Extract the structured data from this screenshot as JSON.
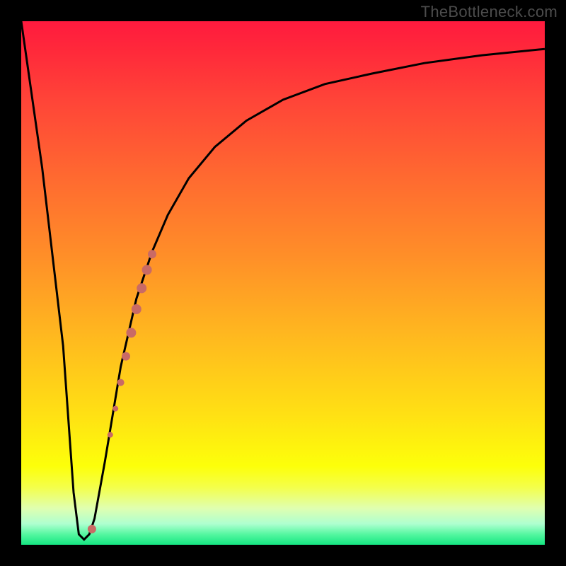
{
  "watermark": "TheBottleneck.com",
  "chart_data": {
    "type": "line",
    "title": "",
    "xlabel": "",
    "ylabel": "",
    "xlim": [
      0,
      100
    ],
    "ylim": [
      0,
      100
    ],
    "series": [
      {
        "name": "bottleneck-curve",
        "x": [
          0,
          4,
          8,
          10,
          11,
          12,
          13,
          14,
          16,
          19,
          22,
          25,
          28,
          32,
          37,
          43,
          50,
          58,
          67,
          77,
          88,
          100
        ],
        "y": [
          100,
          72,
          38,
          10,
          2,
          1,
          2,
          5,
          16,
          34,
          47,
          56,
          63,
          70,
          76,
          81,
          85,
          88,
          90,
          92,
          93.5,
          94.7
        ]
      }
    ],
    "markers": {
      "name": "highlight-dots",
      "color": "#c96a65",
      "points": [
        {
          "x": 13.5,
          "y": 3.0,
          "r": 6
        },
        {
          "x": 17.0,
          "y": 21.0,
          "r": 4
        },
        {
          "x": 18.0,
          "y": 26.0,
          "r": 4
        },
        {
          "x": 19.0,
          "y": 31.0,
          "r": 5
        },
        {
          "x": 20.0,
          "y": 36.0,
          "r": 6
        },
        {
          "x": 21.0,
          "y": 40.5,
          "r": 7
        },
        {
          "x": 22.0,
          "y": 45.0,
          "r": 7
        },
        {
          "x": 23.0,
          "y": 49.0,
          "r": 7
        },
        {
          "x": 24.0,
          "y": 52.5,
          "r": 7
        },
        {
          "x": 25.0,
          "y": 55.5,
          "r": 6
        }
      ]
    },
    "gradient_stops": [
      {
        "pos": 0,
        "color": "#ff1a3e"
      },
      {
        "pos": 50,
        "color": "#ffad22"
      },
      {
        "pos": 85,
        "color": "#fdff0a"
      },
      {
        "pos": 100,
        "color": "#15e682"
      }
    ]
  }
}
